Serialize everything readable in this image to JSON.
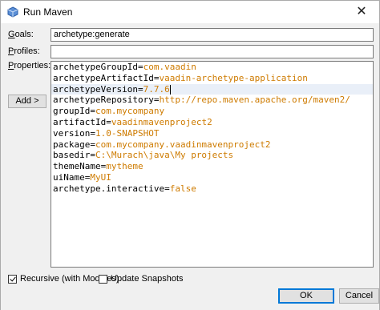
{
  "window": {
    "title": "Run Maven",
    "close_glyph": "✕"
  },
  "goals": {
    "label_key": "G",
    "label_rest": "oals:",
    "value": "archetype:generate"
  },
  "profiles": {
    "label_key": "P",
    "label_rest": "rofiles:",
    "value": ""
  },
  "properties": {
    "label_key": "P",
    "label_rest": "roperties:",
    "add_button": "Add >",
    "lines": [
      {
        "key": "archetypeGroupId=",
        "value": "com.vaadin"
      },
      {
        "key": "archetypeArtifactId=",
        "value": "vaadin-archetype-application"
      },
      {
        "key": "archetypeVersion=",
        "value": "7.7.6"
      },
      {
        "key": "archetypeRepository=",
        "value": "http://repo.maven.apache.org/maven2/"
      },
      {
        "key": "groupId=",
        "value": "com.mycompany"
      },
      {
        "key": "artifactId=",
        "value": "vaadinmavenproject2"
      },
      {
        "key": "version=",
        "value": "1.0-SNAPSHOT"
      },
      {
        "key": "package=",
        "value": "com.mycompany.vaadinmavenproject2"
      },
      {
        "key": "basedir=",
        "value": "C:\\Murach\\java\\My projects"
      },
      {
        "key": "themeName=",
        "value": "mytheme"
      },
      {
        "key": "uiName=",
        "value": "MyUI"
      },
      {
        "key": "archetype.interactive=",
        "value": "false"
      }
    ]
  },
  "options": {
    "recursive": {
      "label": "Recursive (with Modules)",
      "checked": true
    },
    "update_snapshots": {
      "label": "Update Snapshots",
      "checked": false
    }
  },
  "buttons": {
    "ok": "OK",
    "cancel": "Cancel"
  },
  "colors": {
    "value_text": "#ce7b00",
    "accent": "#0078d7"
  }
}
